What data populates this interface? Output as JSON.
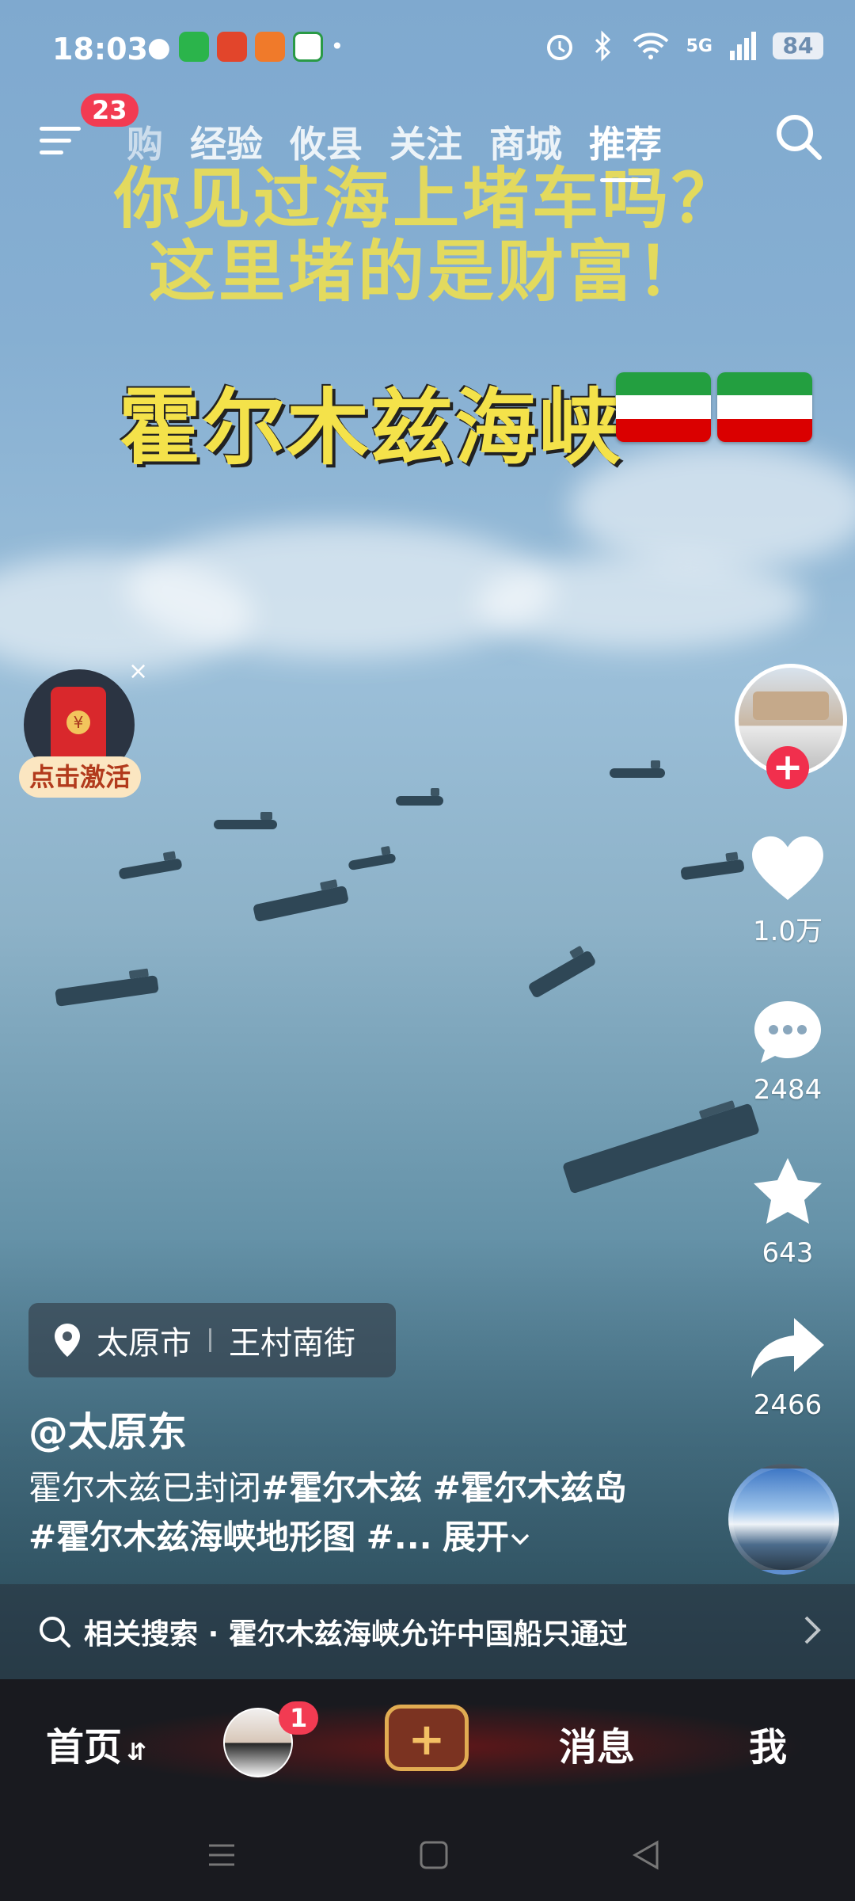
{
  "status_bar": {
    "time": "18:03",
    "network": "5G",
    "battery": "84",
    "app_icons": [
      "wechat-icon",
      "green-app-icon",
      "red-app-icon",
      "orange-app-icon",
      "green-badge-app-icon"
    ]
  },
  "top_nav": {
    "menu_badge": "23",
    "tabs": [
      "购",
      "经验",
      "攸县",
      "关注",
      "商城",
      "推荐"
    ],
    "active_tab": "推荐"
  },
  "video": {
    "overlay_line1": "你见过海上堵车吗？",
    "overlay_line2": "这里堵的是财富！",
    "overlay_title": "霍尔木兹海峡",
    "flag_colors": [
      "#239f40",
      "#ffffff",
      "#da0000"
    ]
  },
  "promo": {
    "activate_label": "点击激活",
    "close_symbol": "×",
    "coin_symbol": "¥"
  },
  "sidebar": {
    "follow_symbol": "+",
    "likes": "1.0万",
    "comments": "2484",
    "favorites": "643",
    "shares": "2466"
  },
  "post": {
    "location_city": "太原市",
    "location_street": "王村南街",
    "author": "@太原东",
    "desc_text": "霍尔木兹已封闭",
    "desc_tag1": "#霍尔木兹",
    "desc_tag2": "#霍尔木兹岛",
    "desc_tag3": "#霍尔木兹海峡地形图",
    "desc_tag4": "#...",
    "expand_label": "展开"
  },
  "related_search": {
    "prefix": "相关搜索",
    "separator": "·",
    "query": "霍尔木兹海峡允许中国船只通过"
  },
  "bottom_nav": {
    "home": "首页",
    "friend_badge": "1",
    "create_symbol": "+",
    "messages": "消息",
    "me": "我"
  },
  "colors": {
    "accent_red": "#f23b52",
    "overlay_yellow": "#f4e24a",
    "create_gold": "#e1ac52"
  }
}
